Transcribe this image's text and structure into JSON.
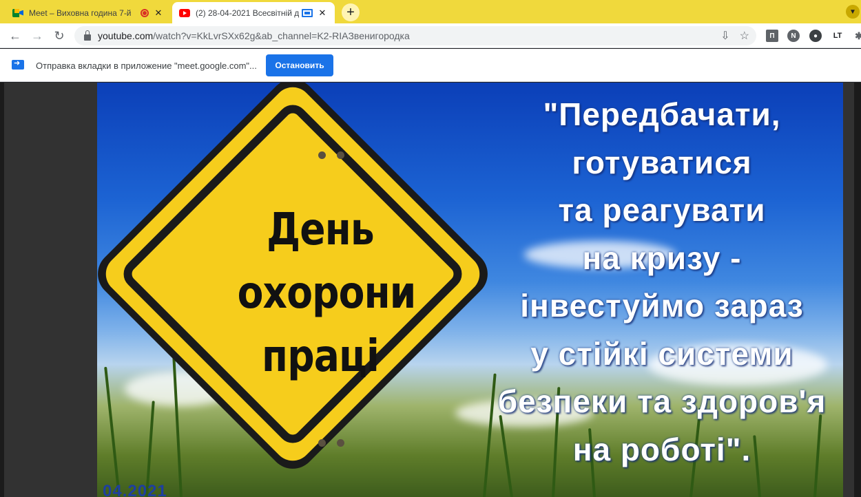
{
  "tabs": [
    {
      "title": "Meet – Виховна година 7-й",
      "favicon": "meet-icon",
      "state": "inactive",
      "recording": true
    },
    {
      "title": "(2) 28-04-2021 Всесвітній де",
      "favicon": "youtube-icon",
      "state": "active",
      "casting": true
    }
  ],
  "toolbar": {
    "url_host": "youtube.com",
    "url_rest": "/watch?v=KkLvrSXx62g&ab_channel=K2-RIAЗвенигородка",
    "extensions": [
      "П",
      "N",
      "",
      "LT"
    ]
  },
  "infobar": {
    "message": "Отправка вкладки в приложение \"meet.google.com\"...",
    "stop_label": "Остановить"
  },
  "video": {
    "sign_lines": [
      "День",
      "охорони",
      "праці"
    ],
    "quote_lines": [
      "\"Передбачати,",
      "готуватися",
      "та реагувати",
      "на кризу -",
      "інвестуймо зараз",
      "у стійкі системи",
      "безпеки та здоров'я",
      "на роботі\"."
    ],
    "date_fragment": "04.2021"
  },
  "colors": {
    "tabstrip": "#f0d93c",
    "accent": "#1a73e8",
    "sign_yellow": "#f6cd1c"
  }
}
